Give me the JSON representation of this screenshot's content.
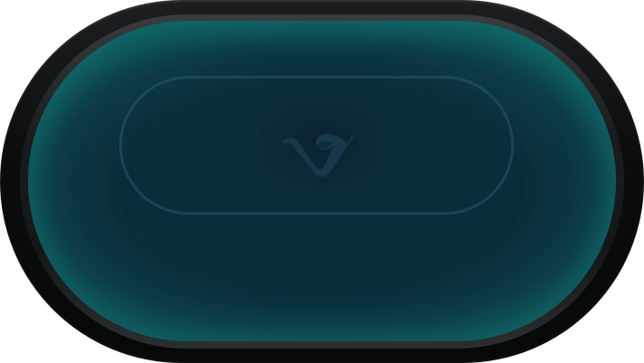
{
  "table": {
    "felt_color": "#0b2c3b",
    "felt_edge_glow": "#126e6c",
    "rail_color": "#0b0c0d",
    "betting_line_color": "#285a6e",
    "logo_icon": "v-logo-icon"
  }
}
